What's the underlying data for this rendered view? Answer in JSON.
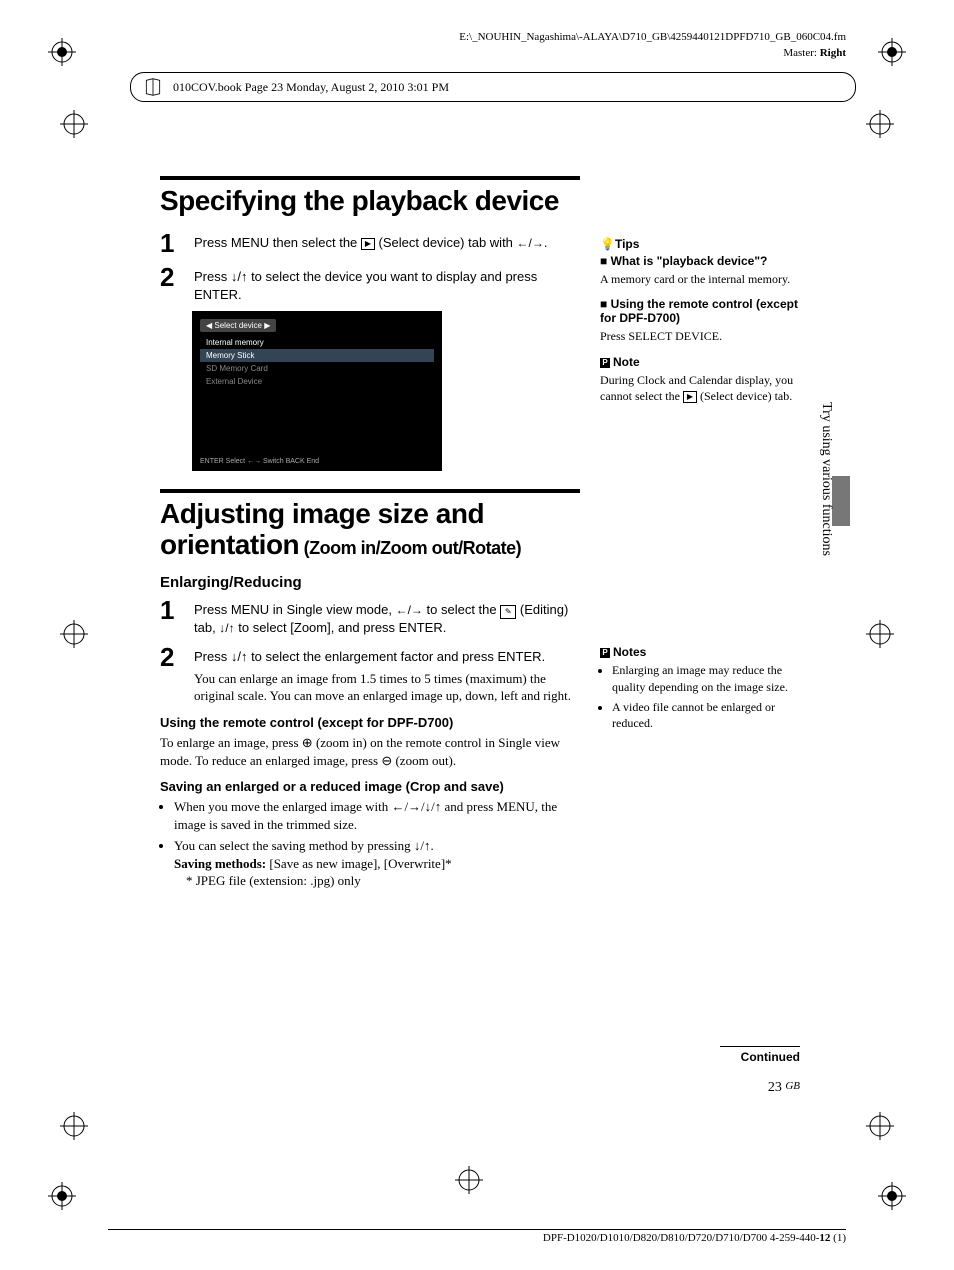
{
  "header": {
    "path": "E:\\_NOUHIN_Nagashima\\-ALAYA\\D710_GB\\4259440121DPFD710_GB_060C04.fm",
    "master_label": "Master:",
    "master_value": "Right",
    "book_info": "010COV.book  Page 23  Monday, August 2, 2010  3:01 PM"
  },
  "section1": {
    "title": "Specifying the playback device",
    "steps": [
      "Press MENU then select the __ICON__ (Select device) tab with ←/→.",
      "Press ↓/↑ to select the device you want to display and press ENTER."
    ],
    "screenshot": {
      "tab": "Select device",
      "items": [
        "Internal memory",
        "Memory Stick",
        "SD Memory Card",
        "External Device"
      ],
      "footer": "ENTER Select  ←→ Switch  BACK End"
    }
  },
  "section2": {
    "title_main": "Adjusting image size and orientation",
    "title_sub": " (Zoom in/Zoom out/Rotate)",
    "sub_heading": "Enlarging/Reducing",
    "step1": "Press MENU in Single view mode, ←/→ to select the __ICON__ (Editing) tab, ↓/↑ to select [Zoom], and press ENTER.",
    "step2_main": "Press ↓/↑ to select the enlargement factor and press ENTER.",
    "step2_note": "You can enlarge an image from 1.5 times to 5 times (maximum) the original scale. You can move an enlarged image up, down, left and right.",
    "remote_heading": "Using the remote control (except for DPF-D700)",
    "remote_text": "To enlarge an image, press ⊕ (zoom in) on the remote control in Single view mode. To reduce an enlarged image, press ⊖ (zoom out).",
    "save_heading": "Saving an enlarged or a reduced image (Crop and save)",
    "save_b1": "When you move the enlarged image with ←/→/↓/↑ and press MENU, the image is saved in the trimmed size.",
    "save_b2": "You can select the saving method by pressing ↓/↑.",
    "save_methods_label": "Saving methods:",
    "save_methods_value": " [Save as new image],  [Overwrite]*",
    "save_footnote": "* JPEG file (extension: .jpg) only"
  },
  "sidebar": {
    "tips_label": "Tips",
    "tip1_head": "What is \"playback device\"?",
    "tip1_body": "A memory card or the internal memory.",
    "tip2_head": "Using the remote control (except for DPF-D700)",
    "tip2_body": "Press SELECT DEVICE.",
    "note1_label": "Note",
    "note1_body_a": "During Clock and Calendar display, you cannot select the ",
    "note1_body_b": " (Select device) tab.",
    "notes2_label": "Notes",
    "notes2_b1": "Enlarging an image may reduce the quality depending on the image size.",
    "notes2_b2": "A video file cannot be enlarged or reduced.",
    "vertical_label": "Try using various functions"
  },
  "footer": {
    "continued": "Continued",
    "page_number": "23",
    "page_suffix": "GB",
    "doc_line": "DPF-D1020/D1010/D820/D810/D720/D710/D700 4-259-440-",
    "doc_bold": "12",
    "doc_paren": " (1)"
  }
}
